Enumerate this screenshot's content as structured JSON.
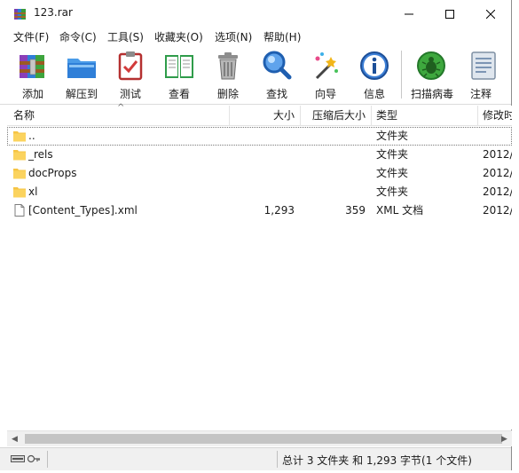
{
  "window": {
    "title": "123.rar"
  },
  "menu": [
    "文件(F)",
    "命令(C)",
    "工具(S)",
    "收藏夹(O)",
    "选项(N)",
    "帮助(H)"
  ],
  "toolbar": [
    {
      "label": "添加",
      "icon": "add-archive-icon"
    },
    {
      "label": "解压到",
      "icon": "extract-to-icon"
    },
    {
      "label": "测试",
      "icon": "test-icon"
    },
    {
      "label": "查看",
      "icon": "view-icon"
    },
    {
      "label": "删除",
      "icon": "delete-icon"
    },
    {
      "label": "查找",
      "icon": "find-icon"
    },
    {
      "label": "向导",
      "icon": "wizard-icon"
    },
    {
      "label": "信息",
      "icon": "info-icon"
    },
    {
      "label": "扫描病毒",
      "icon": "virus-scan-icon"
    },
    {
      "label": "注释",
      "icon": "comment-icon"
    }
  ],
  "columns": {
    "name": "名称",
    "size": "大小",
    "packed": "压缩后大小",
    "type": "类型",
    "modified": "修改时"
  },
  "files": [
    {
      "name": "..",
      "size": "",
      "packed": "",
      "type": "文件夹",
      "modified": "",
      "icon": "folder-icon"
    },
    {
      "name": "_rels",
      "size": "",
      "packed": "",
      "type": "文件夹",
      "modified": "2012/",
      "icon": "folder-icon"
    },
    {
      "name": "docProps",
      "size": "",
      "packed": "",
      "type": "文件夹",
      "modified": "2012/",
      "icon": "folder-icon"
    },
    {
      "name": "xl",
      "size": "",
      "packed": "",
      "type": "文件夹",
      "modified": "2012/",
      "icon": "folder-icon"
    },
    {
      "name": "[Content_Types].xml",
      "size": "1,293",
      "packed": "359",
      "type": "XML 文档",
      "modified": "2012/",
      "icon": "file-icon"
    }
  ],
  "status": {
    "summary": "总计 3 文件夹 和 1,293 字节(1 个文件)"
  },
  "colors": {
    "folder": "#f6c444",
    "accent": "#1e6fd9",
    "statusbar": "#f0f0f0"
  }
}
